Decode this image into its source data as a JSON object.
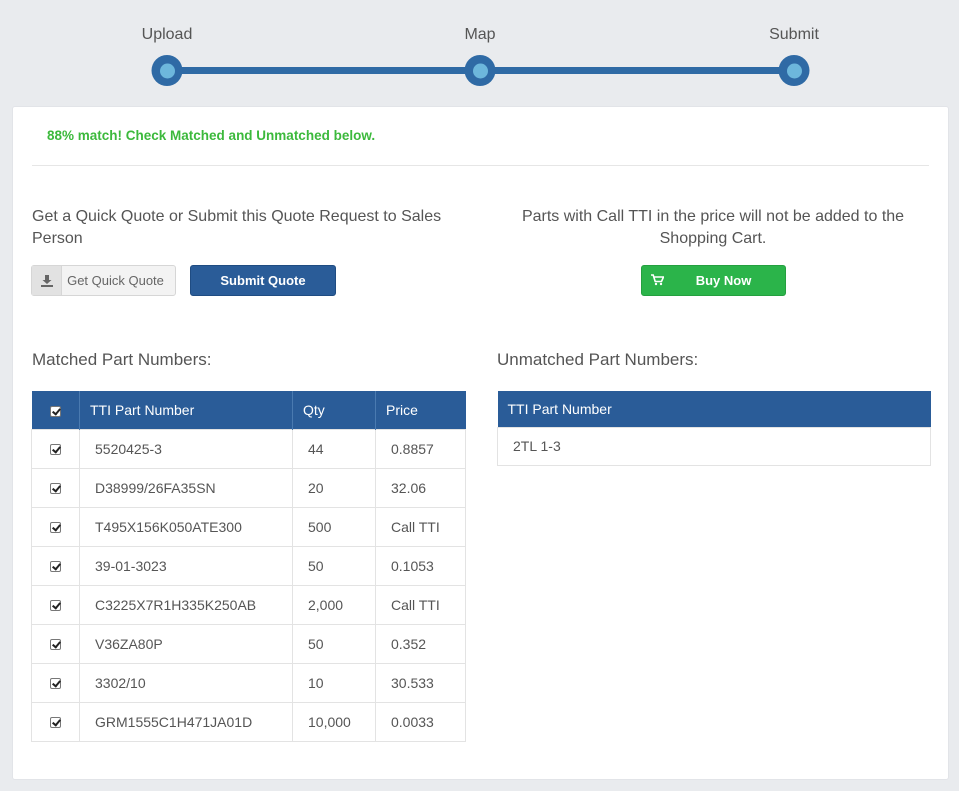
{
  "stepper": {
    "steps": [
      {
        "label": "Upload"
      },
      {
        "label": "Map"
      },
      {
        "label": "Submit"
      }
    ]
  },
  "match_message": "88% match! Check Matched and Unmatched below.",
  "quote": {
    "text": "Get a Quick Quote or Submit this Quote Request to Sales Person",
    "quick_quote_label": "Get Quick Quote",
    "submit_label": "Submit Quote"
  },
  "cart": {
    "notice": "Parts with Call TTI in the price will not be added to the Shopping Cart.",
    "buy_label": "Buy Now"
  },
  "matched": {
    "title": "Matched Part Numbers:",
    "columns": [
      "TTI Part Number",
      "Qty",
      "Price"
    ],
    "rows": [
      {
        "part": "5520425-3",
        "qty": "44",
        "price": "0.8857"
      },
      {
        "part": "D38999/26FA35SN",
        "qty": "20",
        "price": "32.06"
      },
      {
        "part": "T495X156K050ATE300",
        "qty": "500",
        "price": "Call TTI"
      },
      {
        "part": "39-01-3023",
        "qty": "50",
        "price": "0.1053"
      },
      {
        "part": "C3225X7R1H335K250AB",
        "qty": "2,000",
        "price": "Call TTI"
      },
      {
        "part": "V36ZA80P",
        "qty": "50",
        "price": "0.352"
      },
      {
        "part": "3302/10",
        "qty": "10",
        "price": "30.533"
      },
      {
        "part": "GRM1555C1H471JA01D",
        "qty": "10,000",
        "price": "0.0033"
      }
    ]
  },
  "unmatched": {
    "title": "Unmatched Part Numbers:",
    "columns": [
      "TTI Part Number"
    ],
    "rows": [
      {
        "part": "2TL 1-3"
      }
    ]
  },
  "colors": {
    "primary": "#2a5c98",
    "success": "#2bb44a",
    "match_text": "#3cb93c",
    "link": "#2f79b9"
  },
  "icons": {
    "quick_quote": "download-icon",
    "buy_now": "shopping-cart-icon"
  }
}
